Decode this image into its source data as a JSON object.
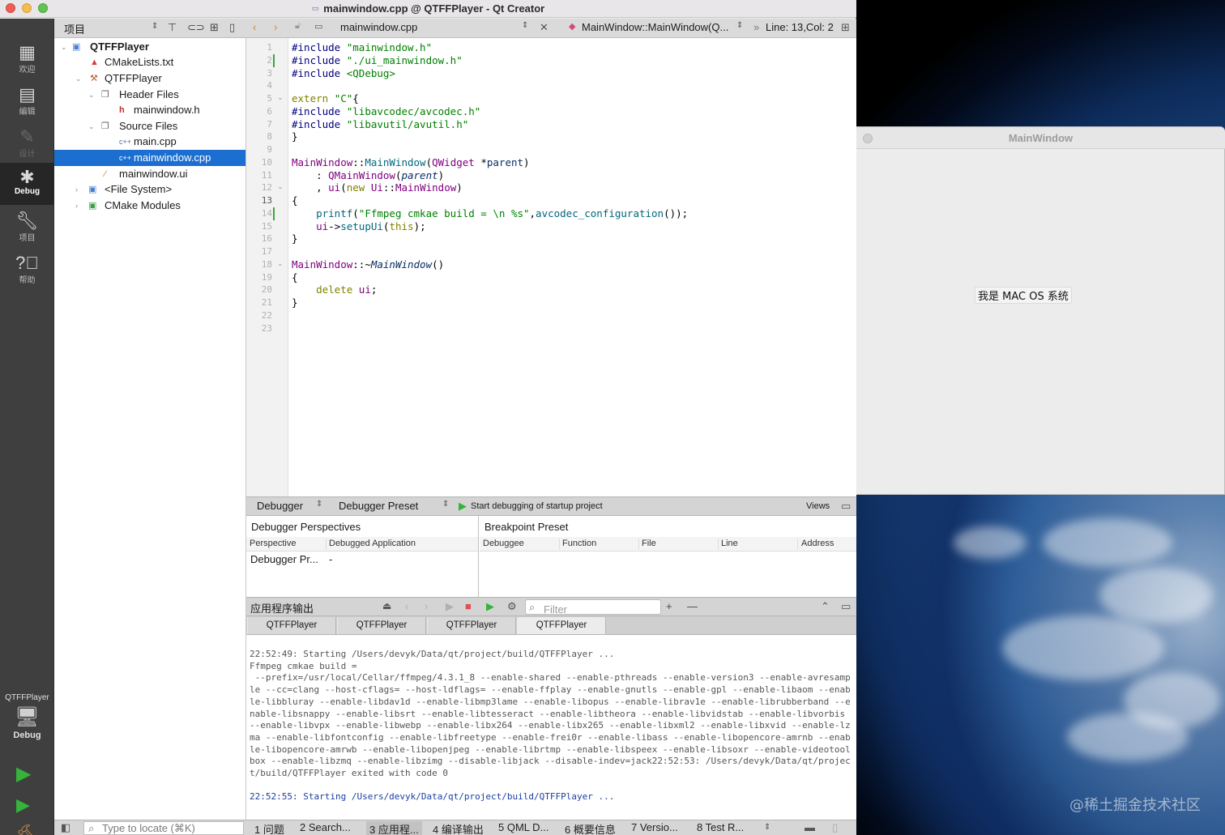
{
  "window": {
    "title": "mainwindow.cpp @ QTFFPlayer - Qt Creator"
  },
  "modes": [
    {
      "label": "欢迎",
      "icon": "grid-icon"
    },
    {
      "label": "编辑",
      "icon": "edit-icon"
    },
    {
      "label": "设计",
      "icon": "pencil-icon"
    },
    {
      "label": "Debug",
      "icon": "bug-icon"
    },
    {
      "label": "项目",
      "icon": "wrench-icon"
    },
    {
      "label": "帮助",
      "icon": "help-icon"
    }
  ],
  "kit": {
    "project": "QTFFPlayer",
    "mode": "Debug"
  },
  "project_pane": {
    "selector": "项目",
    "tree": [
      {
        "label": "QTFFPlayer",
        "bold": true
      },
      {
        "label": "CMakeLists.txt"
      },
      {
        "label": "QTFFPlayer"
      },
      {
        "label": "Header Files"
      },
      {
        "label": "mainwindow.h"
      },
      {
        "label": "Source Files"
      },
      {
        "label": "main.cpp"
      },
      {
        "label": "mainwindow.cpp",
        "selected": true
      },
      {
        "label": "mainwindow.ui"
      },
      {
        "label": "<File System>"
      },
      {
        "label": "CMake Modules"
      }
    ]
  },
  "editor": {
    "file": "mainwindow.cpp",
    "symbol": "MainWindow::MainWindow(Q...",
    "position": "Line: 13,Col: 2",
    "current_line": 13,
    "line_count": 23
  },
  "debugger": {
    "selector": "Debugger",
    "preset": "Debugger Preset",
    "start_text": "Start debugging of startup project",
    "views": "Views",
    "perspectives": {
      "title": "Debugger Perspectives",
      "columns": [
        "Perspective",
        "Debugged Application"
      ],
      "rows": [
        [
          "Debugger Pr...",
          "-"
        ]
      ]
    },
    "breakpoints": {
      "title": "Breakpoint Preset",
      "columns": [
        "Debuggee",
        "Function",
        "File",
        "Line",
        "Address"
      ]
    }
  },
  "output": {
    "title": "应用程序输出",
    "filter_placeholder": "Filter",
    "tabs": [
      "QTFFPlayer",
      "QTFFPlayer",
      "QTFFPlayer",
      "QTFFPlayer"
    ],
    "line1": "22:52:49: Starting /Users/devyk/Data/qt/project/build/QTFFPlayer ...",
    "line2": "Ffmpeg cmkae build =",
    "config": " --prefix=/usr/local/Cellar/ffmpeg/4.3.1_8 --enable-shared --enable-pthreads --enable-version3 --enable-avresample --cc=clang --host-cflags= --host-ldflags= --enable-ffplay --enable-gnutls --enable-gpl --enable-libaom --enable-libbluray --enable-libdav1d --enable-libmp3lame --enable-libopus --enable-librav1e --enable-librubberband --enable-libsnappy --enable-libsrt --enable-libtesseract --enable-libtheora --enable-libvidstab --enable-libvorbis --enable-libvpx --enable-libwebp --enable-libx264 --enable-libx265 --enable-libxml2 --enable-libxvid --enable-lzma --enable-libfontconfig --enable-libfreetype --enable-frei0r --enable-libass --enable-libopencore-amrnb --enable-libopencore-amrwb --enable-libopenjpeg --enable-librtmp --enable-libspeex --enable-libsoxr --enable-videotoolbox --enable-libzmq --enable-libzimg --disable-libjack --disable-indev=jack22:52:53: /Users/devyk/Data/qt/project/build/QTFFPlayer exited with code 0",
    "line_last": "22:52:55: Starting /Users/devyk/Data/qt/project/build/QTFFPlayer ..."
  },
  "statusbar": {
    "locator_placeholder": "Type to locate (⌘K)",
    "tabs": [
      "1 问题",
      "2 Search...",
      "3 应用程...",
      "4 编译输出",
      "5 QML D...",
      "6 概要信息",
      "7 Versio...",
      "8 Test R..."
    ]
  },
  "app_window": {
    "title": "MainWindow",
    "label": "我是 MAC OS 系统"
  },
  "watermark": "@稀土掘金技术社区",
  "colors": {
    "selection": "#1c6fd1",
    "run_green": "#35b33b",
    "modebar": "#3f3f3f"
  }
}
